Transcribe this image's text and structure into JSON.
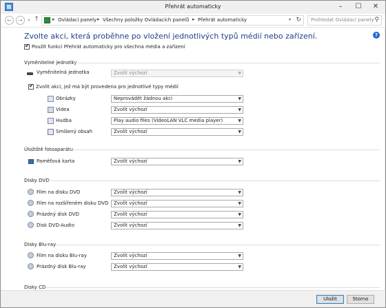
{
  "window": {
    "title": "Přehrát automaticky",
    "controls": {
      "minimize": "–",
      "maximize": "☐",
      "close": "✕"
    }
  },
  "nav": {
    "breadcrumbs": [
      "Ovládací panely",
      "Všechny položky Ovládacích panelů",
      "Přehrát automaticky"
    ],
    "search_placeholder": "Prohledat Ovládací panely"
  },
  "main": {
    "heading": "Zvolte akci, která proběhne po vložení jednotlivých typů médií nebo zařízení.",
    "use_autoplay_label": "Použít funkci Přehrát automaticky pro všechna média a zařízení",
    "sections": {
      "removable": {
        "title": "Vyměnitelné jednotky",
        "drive_label": "Vyměnitelná jednotka",
        "drive_value": "Zvolit výchozí",
        "per_type_label": "Zvolit akci, jež má být provedena pro jednotlivé typy médií",
        "items": [
          {
            "label": "Obrázky",
            "value": "Neprovádět žádnou akci",
            "icon": "pictures-icon"
          },
          {
            "label": "Videa",
            "value": "Zvolit výchozí",
            "icon": "video-icon"
          },
          {
            "label": "Hudba",
            "value": "Play audio files (VideoLAN VLC media player)",
            "icon": "music-icon"
          },
          {
            "label": "Smíšený obsah",
            "value": "Zvolit výchozí",
            "icon": "mixed-content-icon"
          }
        ]
      },
      "camera": {
        "title": "Úložiště fotoaparátu",
        "items": [
          {
            "label": "Paměťová karta",
            "value": "Zvolit výchozí",
            "icon": "memory-card-icon"
          }
        ]
      },
      "dvd": {
        "title": "Disky DVD",
        "items": [
          {
            "label": "Film na disku DVD",
            "value": "Zvolit výchozí",
            "icon": "dvd-disc-icon"
          },
          {
            "label": "Film na rozšířeném disku DVD",
            "value": "Zvolit výchozí",
            "icon": "dvd-disc-icon"
          },
          {
            "label": "Prázdný disk DVD",
            "value": "Zvolit výchozí",
            "icon": "dvd-disc-icon"
          },
          {
            "label": "Disk DVD-Audio",
            "value": "Zvolit výchozí",
            "icon": "dvd-disc-icon"
          }
        ]
      },
      "bluray": {
        "title": "Disky Blu-ray",
        "items": [
          {
            "label": "Film na disku Blu-ray",
            "value": "Zvolit výchozí",
            "icon": "bluray-disc-icon"
          },
          {
            "label": "Prázdný disk Blu-ray",
            "value": "Zvolit výchozí",
            "icon": "bluray-disc-icon"
          }
        ]
      },
      "cd": {
        "title": "Disky CD"
      }
    }
  },
  "footer": {
    "save_label": "Uložit",
    "cancel_label": "Storno"
  }
}
